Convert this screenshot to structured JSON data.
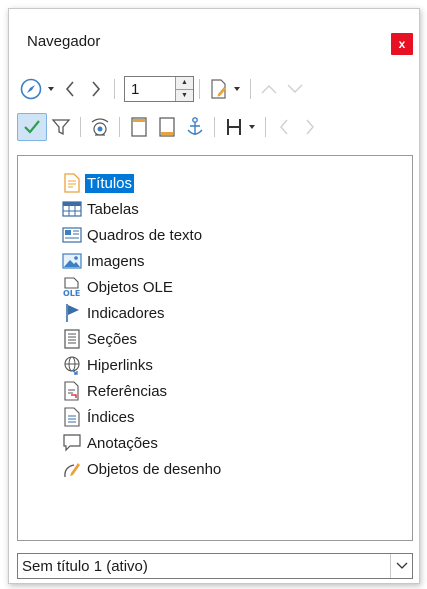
{
  "window": {
    "title": "Navegador",
    "close_label": "x"
  },
  "toolbar1": {
    "page_number": "1"
  },
  "tree": {
    "items": [
      {
        "label": "Títulos",
        "icon": "heading-icon",
        "selected": true
      },
      {
        "label": "Tabelas",
        "icon": "table-icon"
      },
      {
        "label": "Quadros de texto",
        "icon": "text-frame-icon"
      },
      {
        "label": "Imagens",
        "icon": "image-icon"
      },
      {
        "label": "Objetos OLE",
        "icon": "ole-object-icon"
      },
      {
        "label": "Indicadores",
        "icon": "bookmark-flag-icon"
      },
      {
        "label": "Seções",
        "icon": "section-icon"
      },
      {
        "label": "Hiperlinks",
        "icon": "hyperlink-icon"
      },
      {
        "label": "Referências",
        "icon": "reference-icon"
      },
      {
        "label": "Índices",
        "icon": "index-icon"
      },
      {
        "label": "Anotações",
        "icon": "comment-icon"
      },
      {
        "label": "Objetos de desenho",
        "icon": "drawing-object-icon"
      }
    ]
  },
  "document_select": {
    "value": "Sem título 1 (ativo)"
  },
  "colors": {
    "accent": "#0078d7",
    "close": "#e81123",
    "check": "#2e9e4d",
    "icon_orange": "#e8a33d"
  }
}
